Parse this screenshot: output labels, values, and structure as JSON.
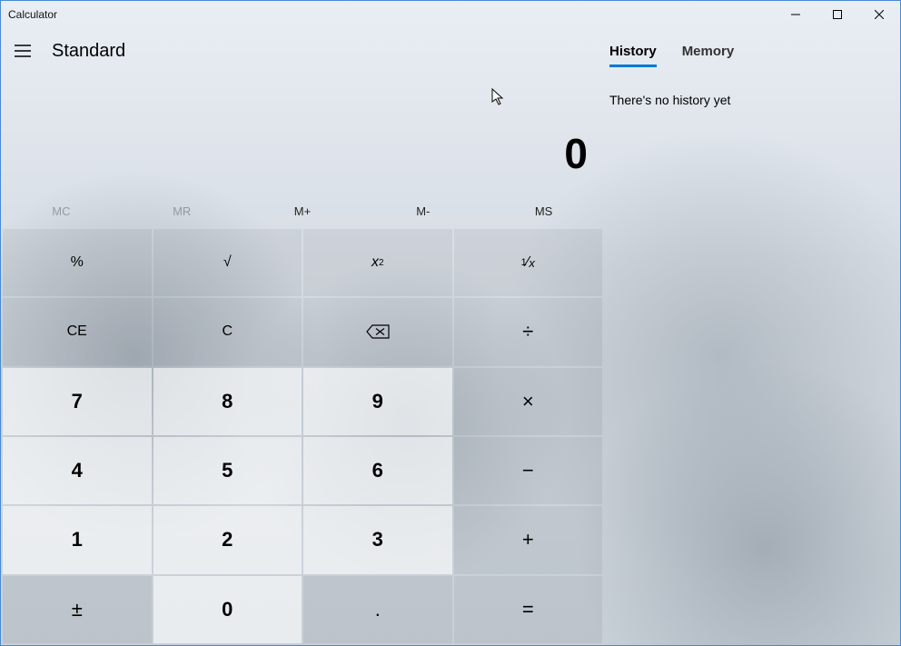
{
  "title": "Calculator",
  "mode": "Standard",
  "display": "0",
  "memory_buttons": [
    "MC",
    "MR",
    "M+",
    "M-",
    "MS"
  ],
  "memory_disabled": [
    true,
    true,
    false,
    false,
    false
  ],
  "tabs": {
    "history": "History",
    "memory": "Memory"
  },
  "history_empty": "There's no history yet",
  "buttons": {
    "percent": "%",
    "sqrt": "√",
    "square": "x²",
    "recip": "¹∕ₓ",
    "ce": "CE",
    "c": "C",
    "div": "÷",
    "mul": "×",
    "sub": "−",
    "add": "+",
    "eq": "=",
    "n7": "7",
    "n8": "8",
    "n9": "9",
    "n4": "4",
    "n5": "5",
    "n6": "6",
    "n1": "1",
    "n2": "2",
    "n3": "3",
    "sign": "±",
    "n0": "0",
    "dot": "."
  }
}
